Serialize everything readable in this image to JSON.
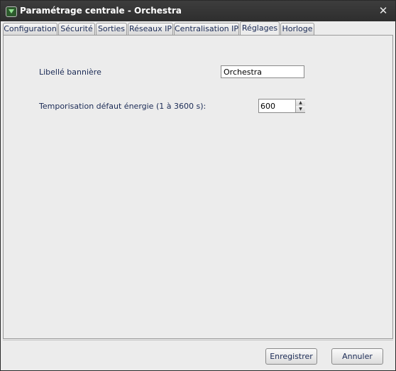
{
  "window": {
    "title": "Paramétrage centrale - Orchestra",
    "close_symbol": "✕"
  },
  "tabs": [
    {
      "label": "Configuration",
      "active": false
    },
    {
      "label": "Sécurité",
      "active": false
    },
    {
      "label": "Sorties",
      "active": false
    },
    {
      "label": "Réseaux IP",
      "active": false
    },
    {
      "label": "Centralisation IP",
      "active": false
    },
    {
      "label": "Réglages",
      "active": true
    },
    {
      "label": "Horloge",
      "active": false
    }
  ],
  "settings": {
    "banner_label": "Libellé bannière",
    "banner_value": "Orchestra",
    "energy_delay_label": "Temporisation défaut énergie (1 à 3600 s):",
    "energy_delay_value": "600"
  },
  "buttons": {
    "save_label": "Enregistrer",
    "cancel_label": "Annuler"
  }
}
